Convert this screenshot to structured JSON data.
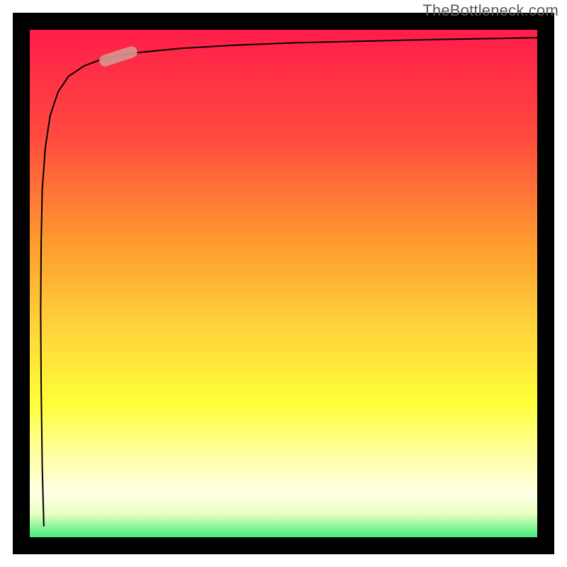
{
  "attribution": "TheBottleneck.com",
  "chart_data": {
    "type": "line",
    "title": "",
    "xlabel": "",
    "ylabel": "",
    "xlim": [
      0,
      100
    ],
    "ylim": [
      0,
      100
    ],
    "grid": false,
    "legend": false,
    "background_gradient": {
      "top": "#ff1a4a",
      "mid_upper": "#ff6e3a",
      "mid": "#ffd23a",
      "mid_lower": "#ffff55",
      "pale_band": "#ffffe0",
      "bottom": "#00e565"
    },
    "frame": {
      "color": "#000000",
      "width": 3
    },
    "series": [
      {
        "name": "curve-main",
        "x": [
          4.3,
          4.0,
          3.8,
          3.7,
          3.8,
          4.0,
          4.6,
          5.5,
          7.0,
          9.0,
          12.0,
          16.0,
          22.0,
          30.0,
          40.0,
          52.0,
          65.0,
          78.0,
          90.0,
          100.0
        ],
        "y": [
          3.8,
          15.0,
          30.0,
          45.0,
          58.0,
          68.0,
          76.0,
          82.0,
          86.5,
          89.5,
          91.5,
          93.0,
          94.0,
          94.8,
          95.4,
          95.9,
          96.2,
          96.5,
          96.7,
          96.9
        ],
        "stroke": "#000000",
        "stroke_width": 2
      }
    ],
    "marker": {
      "name": "highlight-marker",
      "cx": 18.5,
      "cy": 93.3,
      "angle_deg": 18,
      "length": 7.5,
      "width": 2.2,
      "fill": "#d6948e",
      "opacity": 0.92
    }
  }
}
